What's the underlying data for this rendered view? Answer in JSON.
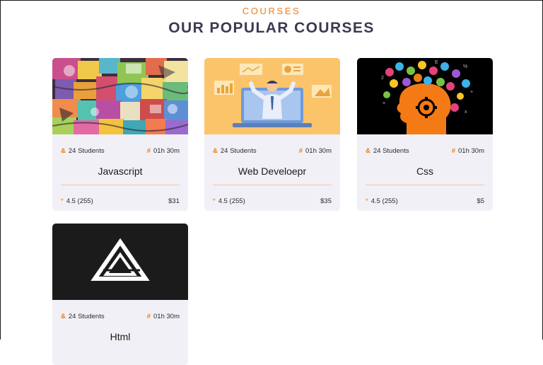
{
  "section": {
    "eyebrow": "COURSES",
    "heading": "OUR POPULAR COURSES"
  },
  "accent_color": "#f07c16",
  "card_background": "#f1f0f6",
  "icons": {
    "students": "&",
    "duration": "#",
    "rating": "*"
  },
  "courses": [
    {
      "title": "Javascript",
      "students": "24 Students",
      "duration": "01h 30m",
      "rating": "4.5 (255)",
      "price": "$31",
      "image": "doodle-collage-illustration"
    },
    {
      "title": "Web Develoepr",
      "students": "24 Students",
      "duration": "01h 30m",
      "rating": "4.5 (255)",
      "price": "$35",
      "image": "presenter-laptop-illustration"
    },
    {
      "title": "Css",
      "students": "24 Students",
      "duration": "01h 30m",
      "rating": "4.5 (255)",
      "price": "$5",
      "image": "head-with-colorful-icons-illustration"
    },
    {
      "title": "Html",
      "students": "24 Students",
      "duration": "01h 30m",
      "image": "triangle-logo-illustration"
    }
  ]
}
